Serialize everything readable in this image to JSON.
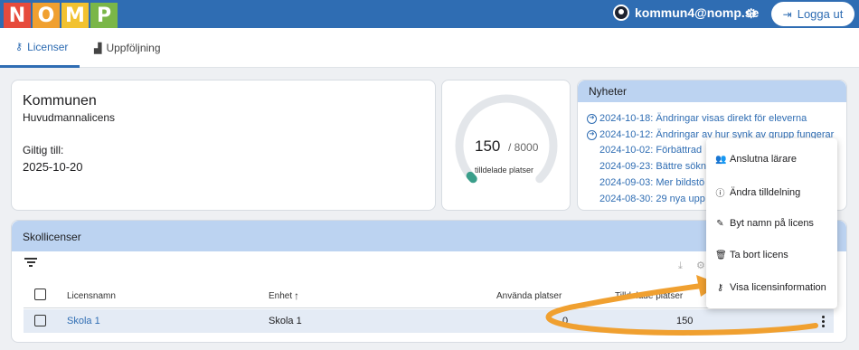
{
  "logo": {
    "letters": [
      {
        "char": "N",
        "color": "#e64b3c"
      },
      {
        "char": "O",
        "color": "#f0a030"
      },
      {
        "char": "M",
        "color": "#f2c230"
      },
      {
        "char": "P",
        "color": "#7ab648"
      }
    ]
  },
  "header": {
    "user": "kommun4@nomp.se",
    "logout": "Logga ut"
  },
  "tabs": [
    {
      "label": "Licenser",
      "icon": "key-icon",
      "active": true
    },
    {
      "label": "Uppföljning",
      "icon": "chart-icon",
      "active": false
    }
  ],
  "kommun": {
    "title": "Kommunen",
    "subtitle": "Huvudmannalicens",
    "valid_label": "Giltig till:",
    "valid_date": "2025-10-20"
  },
  "usage": {
    "assigned": "150",
    "total": "/ 8000",
    "label": "tilldelade platser",
    "fraction": 0.01875
  },
  "news": {
    "title": "Nyheter",
    "items": [
      "2024-10-18: Ändringar visas direkt för eleverna",
      "2024-10-12: Ändringar av hur synk av grupp fungerar",
      "2024-10-02: Förbättrad",
      "2024-09-23: Bättre sökn",
      "2024-09-03: Mer bildstö",
      "2024-08-30: 29 nya upp"
    ]
  },
  "skollicenser": {
    "title": "Skollicenser",
    "columns": {
      "name": "Licensnamn",
      "unit": "Enhet",
      "unit_sort": "↑",
      "used": "Använda platser",
      "assigned": "Tilldelade platser"
    },
    "rows": [
      {
        "name": "Skola 1",
        "unit": "Skola 1",
        "used": "0",
        "assigned": "150"
      }
    ]
  },
  "menu": {
    "items": [
      {
        "label": "Anslutna lärare",
        "icon": "users-icon"
      },
      {
        "label": "Ändra tilldelning",
        "icon": "info-icon"
      },
      {
        "label": "Byt namn på licens",
        "icon": "edit-icon"
      },
      {
        "label": "Ta bort licens",
        "icon": "trash-icon"
      },
      {
        "label": "Visa licensinformation",
        "icon": "key-icon"
      }
    ]
  },
  "colors": {
    "primary": "#2f6db3",
    "header_bg": "#bcd3f1",
    "annotation_arrow": "#f0a030"
  }
}
